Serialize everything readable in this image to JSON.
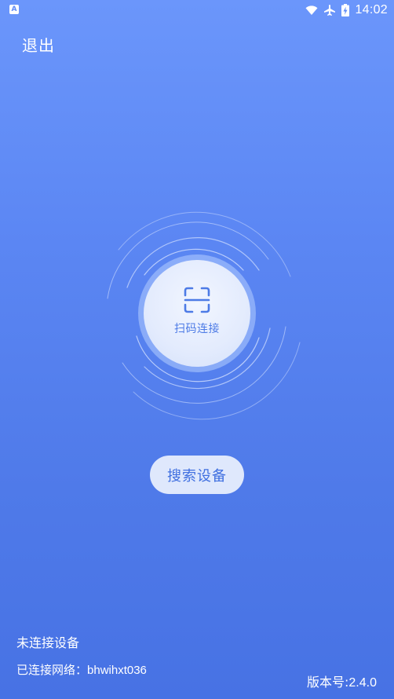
{
  "status_bar": {
    "left_icon": "A",
    "time": "14:02",
    "icons": [
      "wifi-icon",
      "airplane-icon",
      "battery-charging-icon"
    ]
  },
  "header": {
    "exit_label": "退出"
  },
  "scan": {
    "label": "扫码连接",
    "icon": "scan-frame-icon"
  },
  "search": {
    "label": "搜索设备"
  },
  "footer": {
    "connection_status": "未连接设备",
    "network_label": "已连接网络：",
    "network_name": "bhwihxt036",
    "version_label": "版本号:",
    "version_value": "2.4.0"
  },
  "colors": {
    "background_top": "#6b96fb",
    "background_bottom": "#4772e4",
    "accent": "#4d7be6",
    "button_bg": "#dfe8fc"
  }
}
